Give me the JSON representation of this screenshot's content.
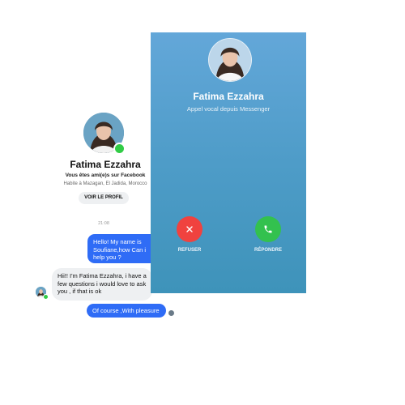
{
  "profile": {
    "name": "Fatima Ezzahra",
    "friends_text": "Vous êtes ami(e)s sur Facebook",
    "lives_text": "Habite à Mazagan, El Jadida, Morocco",
    "view_profile_label": "VOIR LE PROFIL",
    "online": true
  },
  "conversation": {
    "timestamp": "21:08",
    "messages": [
      {
        "direction": "out",
        "text": "Hello! My name is Soufiane,how Can i help you ?"
      },
      {
        "direction": "in",
        "text": "Hii!! I'm Fatima Ezzahra, i have a few questions i would love to ask you , if that is ok"
      },
      {
        "direction": "out",
        "text": "Of course ,With pleasure"
      }
    ]
  },
  "call": {
    "caller_name": "Fatima Ezzahra",
    "subtitle": "Appel vocal depuis Messenger",
    "decline_label": "REFUSER",
    "accept_label": "RÉPONDRE",
    "background_color": "#4e9cc8",
    "decline_color": "#f0423f",
    "accept_color": "#33c14e"
  },
  "icons": {
    "decline": "close-icon",
    "accept": "phone-icon"
  },
  "colors": {
    "outgoing_bubble": "#2f6cf6",
    "incoming_bubble": "#eef0f2",
    "online": "#31cc46"
  }
}
